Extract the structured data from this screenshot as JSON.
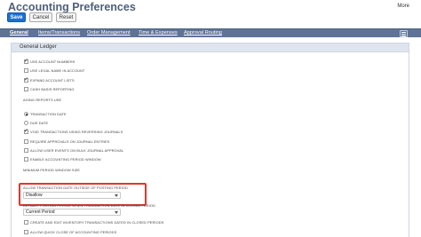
{
  "header": {
    "title": "Accounting Preferences",
    "more_label": "More"
  },
  "toolbar": {
    "save_label": "Save",
    "cancel_label": "Cancel",
    "reset_label": "Reset"
  },
  "tabs": [
    {
      "label": "General",
      "active": true
    },
    {
      "label": "Items/Transactions",
      "active": false
    },
    {
      "label": "Order Management",
      "active": false
    },
    {
      "label": "Time & Expenses",
      "active": false
    },
    {
      "label": "Approval Routing",
      "active": false
    }
  ],
  "section": {
    "title": "General Ledger"
  },
  "options": {
    "use_account_numbers": {
      "label": "USE ACCOUNT NUMBERS",
      "checked": true
    },
    "use_legal_name": {
      "label": "USE LEGAL NAME IN ACCOUNT",
      "checked": false
    },
    "expand_account_lists": {
      "label": "EXPAND ACCOUNT LISTS",
      "checked": true
    },
    "cash_basis_reporting": {
      "label": "CASH BASIS REPORTING",
      "checked": false
    },
    "aging_reports_use": {
      "label": "AGING REPORTS USE"
    },
    "transaction_date": {
      "label": "TRANSACTION DATE",
      "selected": true
    },
    "due_date": {
      "label": "DUE DATE",
      "selected": false
    },
    "void_transactions": {
      "label": "VOID TRANSACTIONS USING REVERSING JOURNALS",
      "checked": true
    },
    "require_approvals": {
      "label": "REQUIRE APPROVALS ON JOURNAL ENTRIES",
      "checked": false
    },
    "allow_user_events": {
      "label": "ALLOW USER EVENTS ON BULK JOURNAL APPROVAL",
      "checked": false
    },
    "enable_accounting_period_window": {
      "label": "ENABLE ACCOUNTING PERIOD WINDOW",
      "checked": false
    },
    "minimum_period_window_size": {
      "label": "MINIMUM PERIOD WINDOW SIZE"
    },
    "allow_outside_posting_period": {
      "label": "ALLOW TRANSACTION DATE OUTSIDE OF POSTING PERIOD",
      "value": "Disallow"
    },
    "default_posting_period": {
      "label": "DEFAULT POSTING PERIOD WHEN TRANSACTION DATE IN CLOSED PERIOD",
      "value": "Current Period"
    },
    "create_edit_inventory": {
      "label": "CREATE AND EDIT INVENTORY TRANSACTIONS DATED IN CLOSED PERIODS",
      "checked": false
    },
    "allow_quick_close": {
      "label": "ALLOW QUICK CLOSE OF ACCOUNTING PERIODS",
      "checked": false
    }
  },
  "colors": {
    "accent": "#1d6fd1",
    "tab_bar": "#5e7396",
    "highlight": "#e4352b"
  }
}
